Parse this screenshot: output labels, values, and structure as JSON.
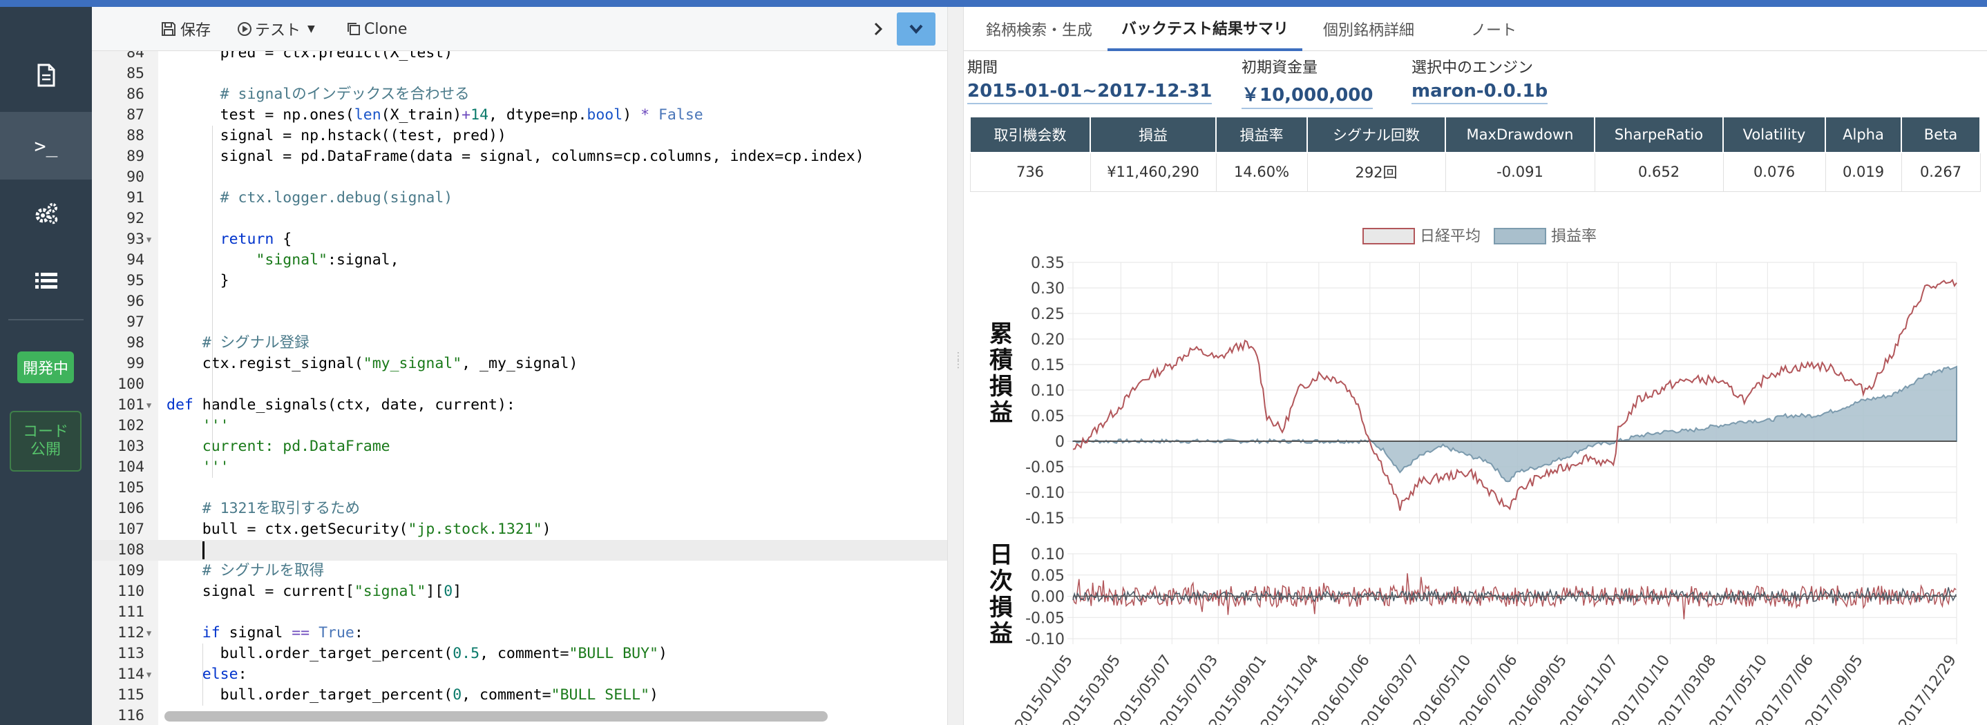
{
  "sidebar": {
    "items": [
      {
        "icon": "document-icon"
      },
      {
        "icon": "terminal-icon",
        "glyph": ">_"
      },
      {
        "icon": "gears-icon"
      },
      {
        "icon": "list-icon"
      }
    ],
    "badge_dev": "開発中",
    "badge_pub_line1": "コード",
    "badge_pub_line2": "公開"
  },
  "toolbar": {
    "save_label": "保存",
    "test_label": "テスト",
    "clone_label": "Clone"
  },
  "code": {
    "lines": [
      {
        "n": "84",
        "html": "      pred = ctx.predict(X_test)"
      },
      {
        "n": "85",
        "html": ""
      },
      {
        "n": "86",
        "html": "      <span class=\"cm\"># signalのインデックスを合わせる</span>"
      },
      {
        "n": "87",
        "html": "      test = np.ones(<span class=\"bi\">len</span>(X_train)<span class=\"op\">+</span><span class=\"num-l\">14</span>, dtype=np.<span class=\"bi\">bool</span>) <span class=\"op\">*</span> <span class=\"lit\">False</span>"
      },
      {
        "n": "88",
        "html": "      signal = np.hstack((test, pred))"
      },
      {
        "n": "89",
        "html": "      signal = pd.DataFrame(data = signal, columns=cp.columns, index=cp.index)"
      },
      {
        "n": "90",
        "html": ""
      },
      {
        "n": "91",
        "html": "      <span class=\"cm\"># ctx.logger.debug(signal)</span>"
      },
      {
        "n": "92",
        "html": ""
      },
      {
        "n": "93",
        "html": "      <span class=\"kw\">return</span> {",
        "fold": true
      },
      {
        "n": "94",
        "html": "          <span class=\"str\">\"signal\"</span>:signal,"
      },
      {
        "n": "95",
        "html": "      }"
      },
      {
        "n": "96",
        "html": ""
      },
      {
        "n": "97",
        "html": ""
      },
      {
        "n": "98",
        "html": "    <span class=\"cm\"># シグナル登録</span>"
      },
      {
        "n": "99",
        "html": "    ctx.regist_signal(<span class=\"str\">\"my_signal\"</span>, _my_signal)"
      },
      {
        "n": "100",
        "html": ""
      },
      {
        "n": "101",
        "html": "<span class=\"kw\">def</span> handle_signals(ctx, date, current):",
        "fold": true
      },
      {
        "n": "102",
        "html": "    <span class=\"str\">'''</span>"
      },
      {
        "n": "103",
        "html": "    <span class=\"str\">current: pd.DataFrame</span>"
      },
      {
        "n": "104",
        "html": "    <span class=\"str\">'''</span>"
      },
      {
        "n": "105",
        "html": ""
      },
      {
        "n": "106",
        "html": "    <span class=\"cm\"># 1321を取引するため</span>"
      },
      {
        "n": "107",
        "html": "    bull = ctx.getSecurity(<span class=\"str\">\"jp.stock.1321\"</span>)"
      },
      {
        "n": "108",
        "html": "",
        "cursor": true
      },
      {
        "n": "109",
        "html": "    <span class=\"cm\"># シグナルを取得</span>"
      },
      {
        "n": "110",
        "html": "    signal = current[<span class=\"str\">\"signal\"</span>][<span class=\"num-l\">0</span>]"
      },
      {
        "n": "111",
        "html": ""
      },
      {
        "n": "112",
        "html": "    <span class=\"kw\">if</span> signal <span class=\"op\">==</span> <span class=\"lit\">True</span>:",
        "fold": true
      },
      {
        "n": "113",
        "html": "      bull.order_target_percent(<span class=\"num-l\">0.5</span>, comment=<span class=\"str\">\"BULL BUY\"</span>)"
      },
      {
        "n": "114",
        "html": "    <span class=\"kw\">else</span>:",
        "fold": true
      },
      {
        "n": "115",
        "html": "      bull.order_target_percent(<span class=\"num-l\">0</span>, comment=<span class=\"str\">\"BULL SELL\"</span>)"
      },
      {
        "n": "116",
        "html": ""
      }
    ]
  },
  "tabs": [
    {
      "label": "銘柄検索・生成"
    },
    {
      "label": "バックテスト結果サマリ",
      "active": true
    },
    {
      "label": "個別銘柄詳細"
    },
    {
      "label": "ノート"
    }
  ],
  "info": {
    "period_label": "期間",
    "period_value": "2015-01-01~2017-12-31",
    "capital_label": "初期資金量",
    "capital_value": "￥10,000,000",
    "engine_label": "選択中のエンジン",
    "engine_value": "maron-0.0.1b"
  },
  "stats": {
    "headers": [
      "取引機会数",
      "損益",
      "損益率",
      "シグナル回数",
      "MaxDrawdown",
      "SharpeRatio",
      "Volatility",
      "Alpha",
      "Beta"
    ],
    "values": [
      "736",
      "¥11,460,290",
      "14.60%",
      "292回",
      "-0.091",
      "0.652",
      "0.076",
      "0.019",
      "0.267"
    ]
  },
  "chart_data": [
    {
      "type": "line",
      "ylabel": "累積損益",
      "ylim": [
        -0.15,
        0.35
      ],
      "yticks": [
        "0.35",
        "0.30",
        "0.25",
        "0.20",
        "0.15",
        "0.10",
        "0.05",
        "0",
        "-0.05",
        "-0.10",
        "-0.15"
      ],
      "legend_position": "top",
      "series": [
        {
          "name": "日経平均",
          "color": "#b2565a",
          "style": "line",
          "x": [
            "2015/01/05",
            "2015/02/01",
            "2015/03/05",
            "2015/04/01",
            "2015/05/07",
            "2015/06/01",
            "2015/06/20",
            "2015/07/03",
            "2015/07/20",
            "2015/08/05",
            "2015/08/20",
            "2015/09/01",
            "2015/09/20",
            "2015/10/10",
            "2015/11/04",
            "2015/12/01",
            "2015/12/20",
            "2016/01/06",
            "2016/01/25",
            "2016/02/12",
            "2016/03/07",
            "2016/04/05",
            "2016/05/10",
            "2016/06/01",
            "2016/06/24",
            "2016/07/06",
            "2016/08/01",
            "2016/09/05",
            "2016/10/01",
            "2016/11/01",
            "2016/11/07",
            "2016/12/01",
            "2017/01/10",
            "2017/02/01",
            "2017/03/08",
            "2017/04/14",
            "2017/05/10",
            "2017/06/01",
            "2017/07/06",
            "2017/08/01",
            "2017/09/05",
            "2017/09/15",
            "2017/10/10",
            "2017/11/01",
            "2017/11/20",
            "2017/12/29"
          ],
          "values": [
            -0.02,
            0.02,
            0.07,
            0.12,
            0.15,
            0.18,
            0.17,
            0.16,
            0.18,
            0.19,
            0.17,
            0.05,
            0.02,
            0.1,
            0.13,
            0.12,
            0.08,
            0.0,
            -0.06,
            -0.13,
            -0.08,
            -0.07,
            -0.06,
            -0.1,
            -0.13,
            -0.1,
            -0.07,
            -0.05,
            -0.03,
            -0.05,
            0.02,
            0.08,
            0.11,
            0.12,
            0.12,
            0.08,
            0.13,
            0.14,
            0.15,
            0.14,
            0.1,
            0.11,
            0.17,
            0.24,
            0.3,
            0.31
          ]
        },
        {
          "name": "損益率",
          "color": "#7c9bae",
          "fill": "#a9bfcc",
          "style": "area",
          "x": [
            "2015/01/05",
            "2015/12/31",
            "2016/01/06",
            "2016/01/25",
            "2016/02/12",
            "2016/03/07",
            "2016/04/05",
            "2016/05/10",
            "2016/06/01",
            "2016/06/24",
            "2016/07/06",
            "2016/08/01",
            "2016/09/05",
            "2016/10/01",
            "2016/11/07",
            "2016/12/01",
            "2017/01/10",
            "2017/02/01",
            "2017/03/08",
            "2017/04/14",
            "2017/05/10",
            "2017/06/01",
            "2017/07/06",
            "2017/08/01",
            "2017/09/05",
            "2017/10/10",
            "2017/11/01",
            "2017/11/20",
            "2017/12/29"
          ],
          "values": [
            0,
            0,
            0,
            -0.02,
            -0.06,
            -0.03,
            -0.01,
            -0.03,
            -0.04,
            -0.08,
            -0.06,
            -0.05,
            -0.03,
            -0.01,
            0.0,
            0.01,
            0.02,
            0.02,
            0.03,
            0.04,
            0.04,
            0.05,
            0.05,
            0.06,
            0.08,
            0.09,
            0.11,
            0.13,
            0.146
          ]
        }
      ]
    },
    {
      "type": "line",
      "ylabel": "日次損益",
      "ylim": [
        -0.1,
        0.1
      ],
      "yticks": [
        "0.10",
        "0.05",
        "0.00",
        "-0.05",
        "-0.10"
      ],
      "xticks": [
        "2015/01/05",
        "2015/03/05",
        "2015/05/07",
        "2015/07/03",
        "2015/09/01",
        "2015/11/04",
        "2016/01/06",
        "2016/03/07",
        "2016/05/10",
        "2016/07/06",
        "2016/09/05",
        "2016/11/07",
        "2017/01/10",
        "2017/03/08",
        "2017/05/10",
        "2017/07/06",
        "2017/09/05",
        "2017/12/29"
      ],
      "series": [
        {
          "name": "日経平均",
          "color": "#b2565a",
          "amplitude": 0.025
        },
        {
          "name": "損益率",
          "color": "#4a5a66",
          "amplitude": 0.012
        }
      ]
    }
  ]
}
